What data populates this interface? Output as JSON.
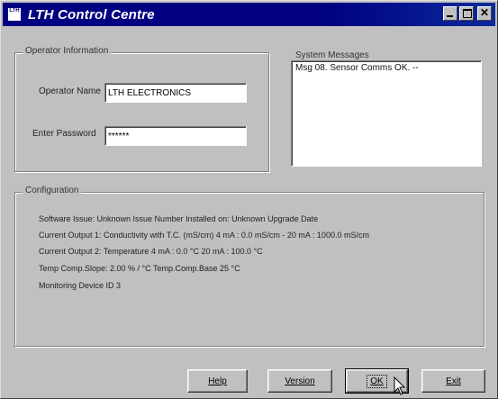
{
  "window": {
    "title": "LTH Control Centre",
    "icon_text": "LTH"
  },
  "operator": {
    "group_label": "Operator Information",
    "name_label": "Operator Name",
    "name_value": "LTH ELECTRONICS",
    "password_label": "Enter Password",
    "password_value": "******"
  },
  "system": {
    "label": "System Messages",
    "messages": [
      "Msg 08. Sensor Comms OK. --"
    ]
  },
  "config": {
    "group_label": "Configuration",
    "software_line": "Software Issue:  Unknown Issue Number          Installed on:  Unknown Upgrade Date",
    "output1_line": "Current Output 1:  Conductivity with T.C. (mS/cm)    4 mA :  0.0 mS/cm   -   20 mA :  1000.0 mS/cm",
    "output2_line": "Current Output 2:  Temperature    4 mA :  0.0 °C    20 mA :  100.0 °C",
    "tempcomp_line": "Temp Comp.Slope:  2.00 % / °C      Temp.Comp.Base 25 °C",
    "device_line": "Monitoring Device ID 3"
  },
  "buttons": {
    "help": "Help",
    "version": "Version",
    "ok": "OK",
    "exit": "Exit"
  },
  "colors": {
    "titlebar": "#000080",
    "window_bg": "#c0c0c0"
  }
}
